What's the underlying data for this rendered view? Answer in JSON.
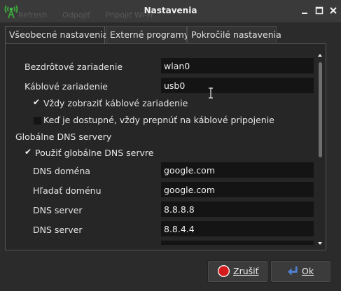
{
  "window": {
    "title": "Nastavenia",
    "background_toolbar": [
      "Refresh",
      "Odpojiť",
      "Pripojiť Wi-Fi"
    ]
  },
  "tabs": [
    {
      "label": "Všeobecné nastavenia",
      "active": true
    },
    {
      "label": "Externé programy",
      "active": false
    },
    {
      "label": "Pokročilé nastavenia",
      "active": false
    }
  ],
  "general": {
    "wireless_label": "Bezdrôtové zariadenie",
    "wireless_value": "wlan0",
    "wired_label": "Káblové zariadenie",
    "wired_value": "usb0",
    "always_show_wired_label": "Vždy zobraziť káblové zariadenie",
    "always_show_wired_checked": true,
    "prefer_wired_label": "Keď je dostupné, vždy prepnúť na káblové pripojenie",
    "prefer_wired_checked": false
  },
  "dns": {
    "section_title": "Globálne DNS servery",
    "use_global_label": "Použiť globálne DNS servre",
    "use_global_checked": true,
    "domain_label": "DNS doména",
    "domain_value": "google.com",
    "search_label": "Hľadať doménu",
    "search_value": "google.com",
    "server1_label": "DNS server",
    "server1_value": "8.8.8.8",
    "server2_label": "DNS server",
    "server2_value": "8.8.4.4"
  },
  "buttons": {
    "cancel_label": "Zrušiť",
    "ok_label": "Ok"
  },
  "icons": {
    "app": "wireless-tower-icon",
    "minimize": "minimize-icon",
    "maximize": "maximize-icon",
    "close": "close-icon",
    "cancel": "stop-icon",
    "ok": "return-arrow-icon"
  },
  "colors": {
    "window_bg": "#2b2b2b",
    "titlebar_bg": "#3a3a3a",
    "field_bg": "#141414",
    "accent_green": "#3aa83a",
    "cancel_red": "#d41a1a",
    "ok_blue": "#4f7fd0"
  }
}
